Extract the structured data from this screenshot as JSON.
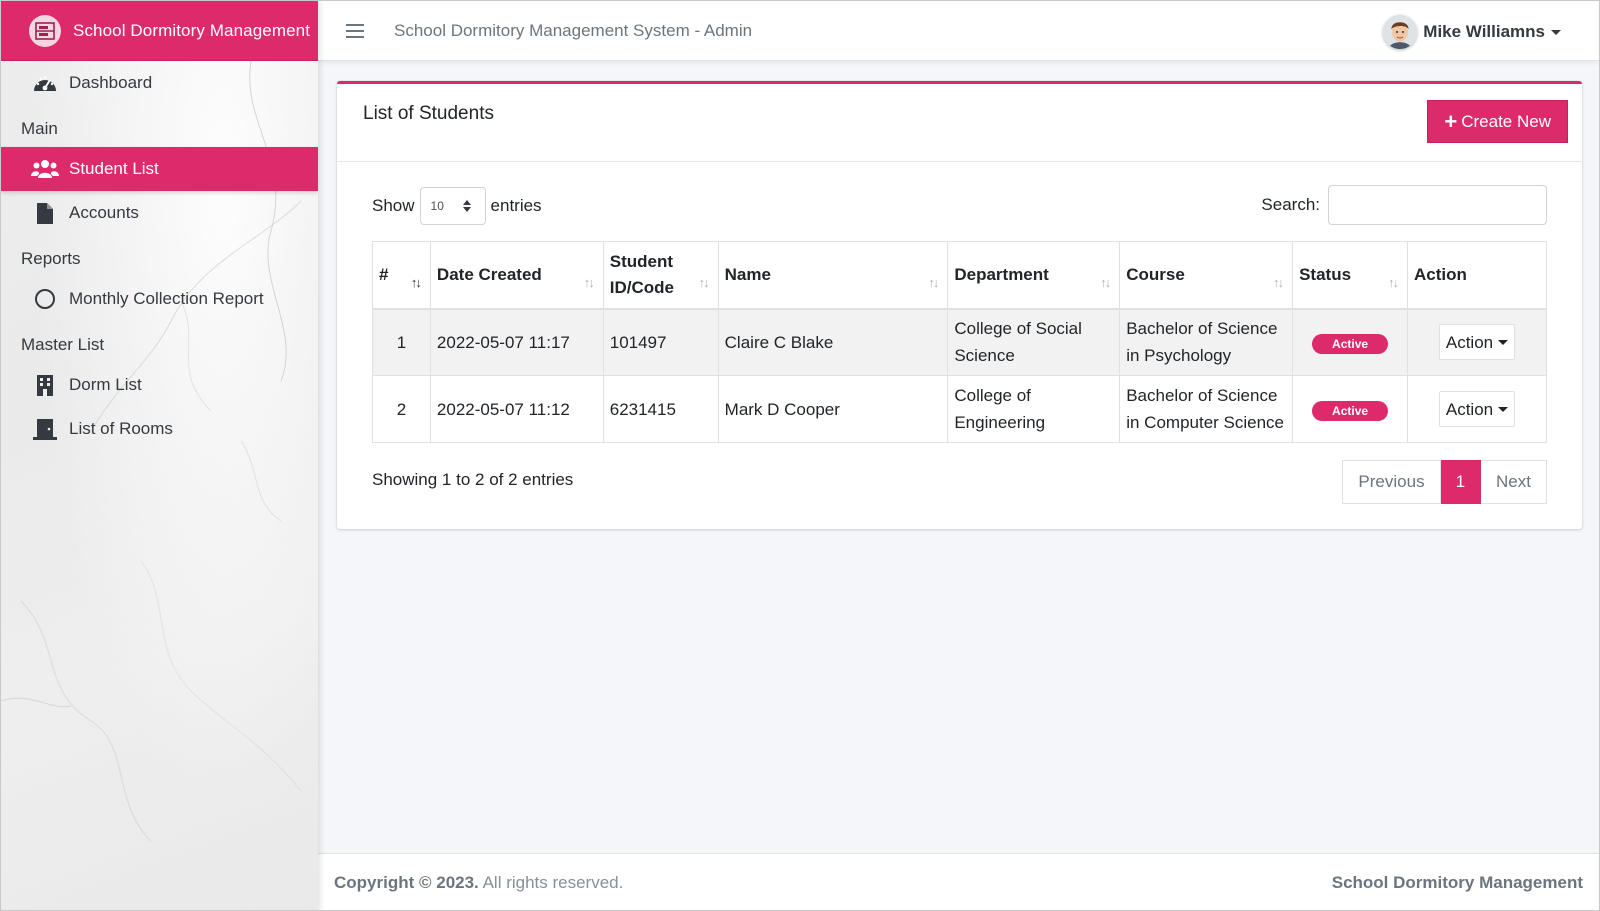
{
  "brand": {
    "title": "School Dormitory Management"
  },
  "topbar": {
    "system_title": "School Dormitory Management System - Admin",
    "user_name": "Mike Williamns"
  },
  "sidebar": {
    "dashboard": "Dashboard",
    "sections": {
      "main": "Main",
      "reports": "Reports",
      "master": "Master List"
    },
    "items": {
      "student_list": "Student List",
      "accounts": "Accounts",
      "monthly_report": "Monthly Collection Report",
      "dorm_list": "Dorm List",
      "rooms": "List of Rooms"
    }
  },
  "card": {
    "title": "List of Students",
    "create_label": "Create New",
    "show_label": "Show",
    "entries_label": "entries",
    "page_length": "10",
    "search_label": "Search:",
    "search_value": ""
  },
  "table": {
    "headers": {
      "num": "#",
      "date": "Date Created",
      "student_id_1": "Student",
      "student_id_2": "ID/Code",
      "name": "Name",
      "department": "Department",
      "course": "Course",
      "status": "Status",
      "action": "Action"
    },
    "rows": [
      {
        "num": "1",
        "date": "2022-05-07 11:17",
        "id": "101497",
        "name": "Claire C Blake",
        "department": "College of Social Science",
        "course": "Bachelor of Science in Psychology",
        "status": "Active",
        "action": "Action"
      },
      {
        "num": "2",
        "date": "2022-05-07 11:12",
        "id": "6231415",
        "name": "Mark D Cooper",
        "department": "College of Engineering",
        "course": "Bachelor of Science in Computer Science",
        "status": "Active",
        "action": "Action"
      }
    ]
  },
  "pagination": {
    "info": "Showing 1 to 2 of 2 entries",
    "previous": "Previous",
    "current": "1",
    "next": "Next"
  },
  "footer": {
    "copyright_bold": "Copyright © 2023.",
    "copyright_rest": " All rights reserved.",
    "right": "School Dormitory Management"
  },
  "colors": {
    "accent": "#dd2a6b"
  },
  "icons": {
    "brand": "dormitory-logo-icon",
    "dashboard": "tachometer-icon",
    "student_list": "users-icon",
    "accounts": "file-icon",
    "monthly_report": "circle-icon",
    "dorm_list": "building-icon",
    "rooms": "door-icon",
    "menu": "hamburger-icon"
  }
}
